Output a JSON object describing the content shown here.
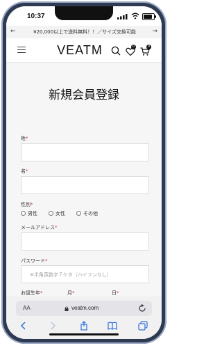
{
  "status_bar": {
    "time": "10:37",
    "battery_level": 0.85
  },
  "promo": {
    "text": "¥20,000以上で送料無料！！／サイズ交換可能",
    "prev_icon": "arrow-left-icon",
    "next_icon": "arrow-right-icon"
  },
  "header": {
    "logo": "VEATM",
    "favorites_count": "0",
    "cart_count": "0",
    "icons": [
      "menu-icon",
      "search-icon",
      "heart-icon",
      "cart-icon"
    ]
  },
  "main": {
    "title": "新規会員登録",
    "fields": {
      "last_name_label": "姓",
      "first_name_label": "名",
      "gender_label": "性別",
      "gender_options": [
        "男性",
        "女性",
        "その他"
      ],
      "email_label": "メールアドレス",
      "password_label": "パスワード",
      "password_placeholder": "※半角英数字７ケタ（ハイフンなし）",
      "birth_year_label": "お誕生年",
      "birth_month_label": "月",
      "birth_day_label": "日",
      "required_mark": "*"
    }
  },
  "browser": {
    "text_size_label": "AA",
    "url": "veatm.com",
    "toolbar_icons": [
      "back-icon",
      "forward-icon",
      "share-icon",
      "bookmarks-icon",
      "tabs-icon"
    ]
  },
  "colors": {
    "required": "#d33333",
    "frame": "#2d3a52"
  }
}
